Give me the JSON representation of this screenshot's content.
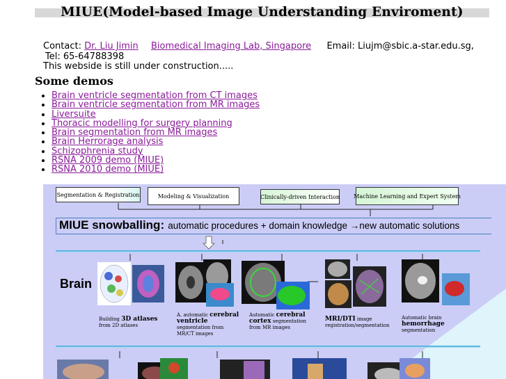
{
  "title": "MIUE(Model-based Image Understanding Enviroment)",
  "contact": {
    "label": "Contact:",
    "person": "Dr. Liu Jimin",
    "lab": "Biomedical Imaging Lab, Singapore",
    "email": "Email: Liujm@sbic.a-star.edu.sg,",
    "tel": "Tel: 65-64788398",
    "notice": "This webside is still under construction....."
  },
  "demos_heading": "Some demos",
  "demos": [
    "Brain ventricle segmentation from CT images",
    "Brain ventricle segmentation from MR images",
    "Liversuite",
    "Thoracic modelling for surgery planning",
    "Brain segmentation from MR images",
    "Brain Herrorage analysis",
    "Schizophrenia study",
    "RSNA 2009 demo (MIUE)",
    "RSNA 2010 demo (MIUE)"
  ],
  "diagram": {
    "boxes": [
      "Segmentation & Registration",
      "Modeling & Visualization",
      "Clinically-driven Interaction",
      "Machine Learning and Expert System"
    ],
    "snow_title": "MIUE snowballing:",
    "snow_text": "automatic procedures + domain knowledge →new automatic solutions",
    "brain_label": "Brain",
    "captions": [
      {
        "pre": "Building",
        "bold": "3D atlases",
        "post": "from 2D atlases"
      },
      {
        "pre": "A. automatic",
        "bold": "cerebral ventricle",
        "post": "segmentation from MR/CT images"
      },
      {
        "pre": "Automatic",
        "bold": "cerebral cortex",
        "post": "segmentation from MR images"
      },
      {
        "pre": "",
        "bold": "MRI/DTI",
        "post": "image registration/segmentation"
      },
      {
        "pre": "Automatic brain",
        "bold": "hemorrhage",
        "post": "segmentation"
      }
    ],
    "colors": {
      "bg": "#cbcdf6",
      "triangle": "#dff4fb",
      "box_green": "#d6f5d6",
      "line": "#2e9fd8"
    }
  }
}
